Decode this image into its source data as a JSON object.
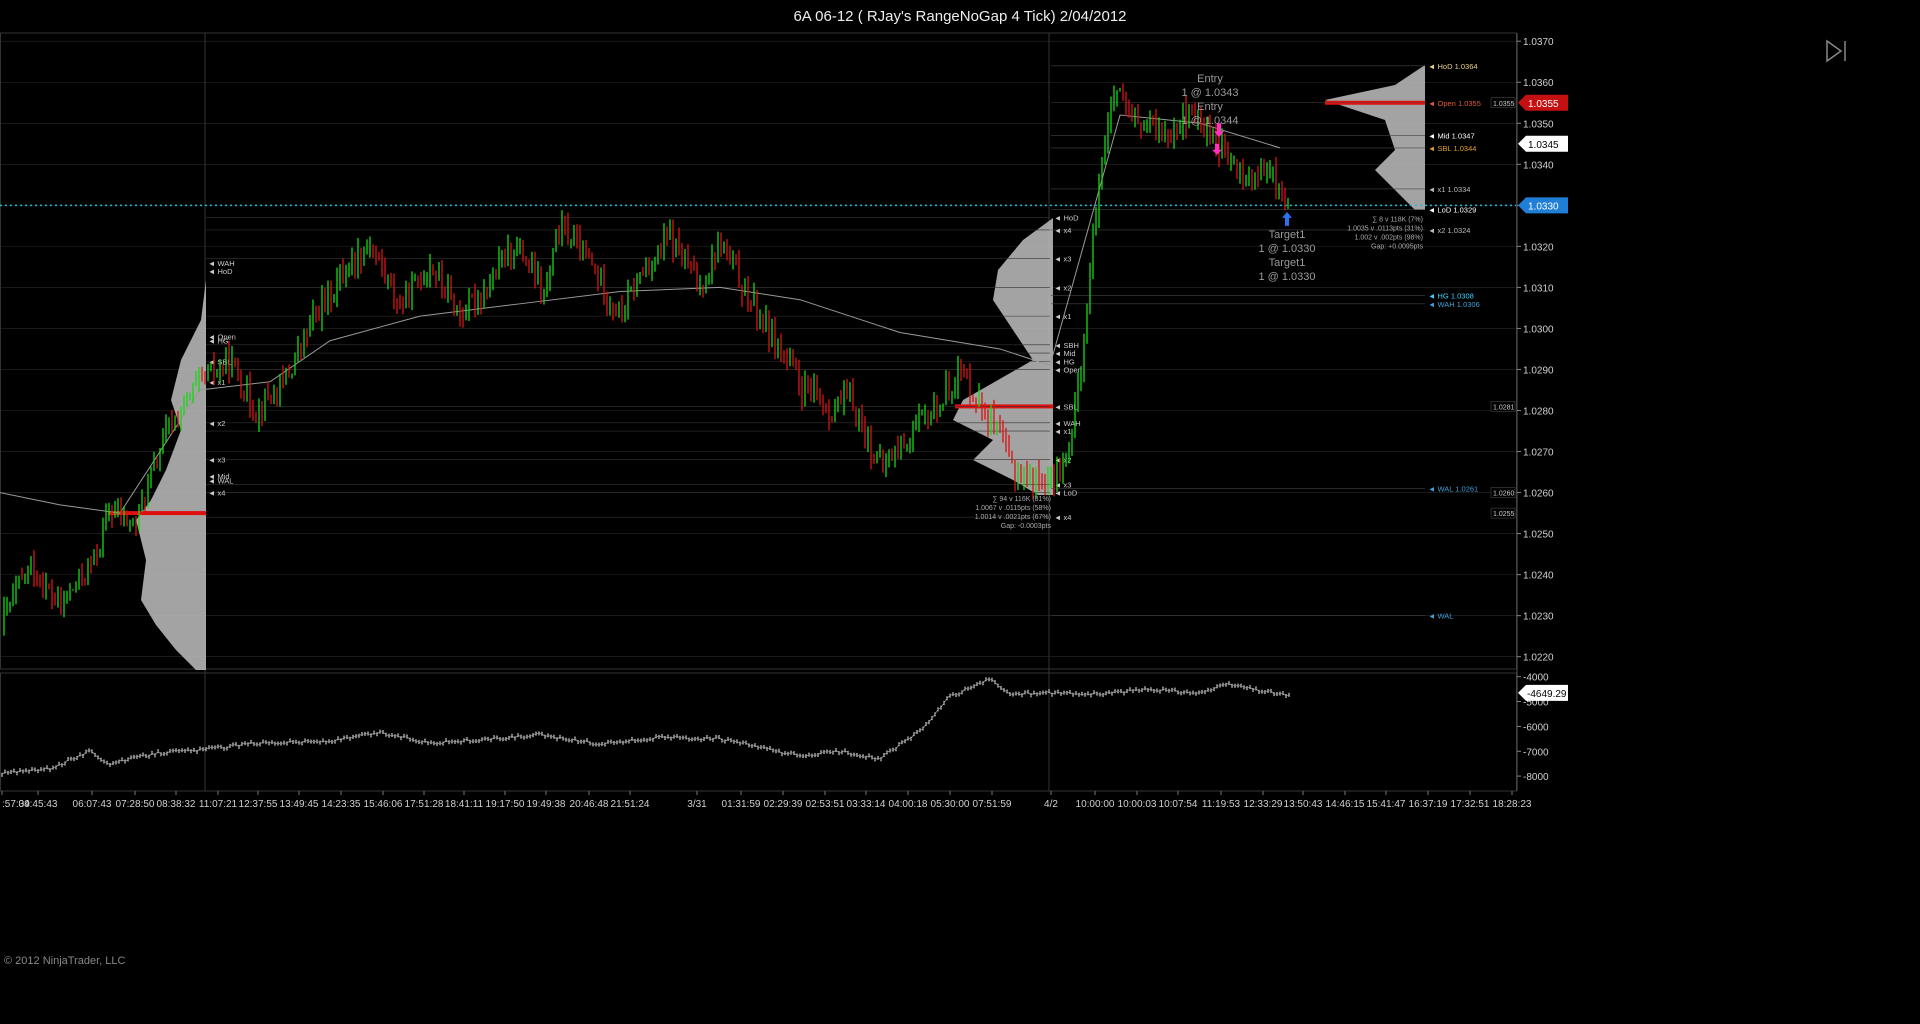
{
  "window": {
    "title": "6A 06-12 ( RJay's RangeNoGap  4 Tick)  2/04/2012"
  },
  "watermark": "© 2012 NinjaTrader, LLC",
  "colors": {
    "background": "#000000",
    "up_bar": "#12d912",
    "down_bar": "#d91212",
    "grid": "#2a2a2a",
    "price_label": "#c41010",
    "last_price_label": "#1f7fd6",
    "dotted_line": "#1fb9d6",
    "profile_fill": "#bfbfbf",
    "poc": "#e01010",
    "vwap_curve": "#9a9a9a"
  },
  "icons": [
    "play-to-end-icon"
  ],
  "chart_data": [
    {
      "type": "candlestick",
      "title": "6A 06-12 ( RJay's RangeNoGap  4 Tick)  2/04/2012",
      "ylim": [
        1.0217,
        1.0372
      ],
      "yticks": [
        "1.0370",
        "1.0360",
        "1.0350",
        "1.0340",
        "1.0330",
        "1.0320",
        "1.0310",
        "1.0300",
        "1.0290",
        "1.0280",
        "1.0270",
        "1.0260",
        "1.0250",
        "1.0240",
        "1.0230",
        "1.0220"
      ],
      "xticks": [
        ":57:39",
        "04:45:43",
        "06:07:43",
        "07:28:50",
        "08:38:32",
        "11:07:21",
        "12:37:55",
        "13:49:45",
        "14:23:35",
        "15:46:06",
        "17:51:28",
        "18:41:11",
        "19:17:50",
        "19:49:38",
        "20:46:48",
        "21:51:24",
        "3/31",
        "01:31:59",
        "02:29:39",
        "02:53:51",
        "03:33:14",
        "04:00:18",
        "05:30:00",
        "07:51:59",
        "4/2",
        "10:00:00",
        "10:00:03",
        "10:07:54",
        "11:19:53",
        "12:33:29",
        "13:50:43",
        "14:46:15",
        "15:41:47",
        "16:37:19",
        "17:32:51",
        "18:28:23"
      ],
      "price_anchors": [
        [
          0,
          1.0228
        ],
        [
          30,
          1.0242
        ],
        [
          60,
          1.0232
        ],
        [
          95,
          1.0244
        ],
        [
          110,
          1.0256
        ],
        [
          135,
          1.0252
        ],
        [
          165,
          1.0274
        ],
        [
          200,
          1.0287
        ],
        [
          230,
          1.0292
        ],
        [
          255,
          1.028
        ],
        [
          285,
          1.0287
        ],
        [
          315,
          1.0303
        ],
        [
          350,
          1.0316
        ],
        [
          370,
          1.0321
        ],
        [
          400,
          1.0305
        ],
        [
          430,
          1.0316
        ],
        [
          460,
          1.0303
        ],
        [
          490,
          1.0311
        ],
        [
          515,
          1.0321
        ],
        [
          545,
          1.0308
        ],
        [
          560,
          1.0325
        ],
        [
          590,
          1.0316
        ],
        [
          620,
          1.0303
        ],
        [
          640,
          1.0313
        ],
        [
          670,
          1.0322
        ],
        [
          700,
          1.031
        ],
        [
          720,
          1.0321
        ],
        [
          750,
          1.0307
        ],
        [
          780,
          1.0295
        ],
        [
          800,
          1.0286
        ],
        [
          830,
          1.028
        ],
        [
          850,
          1.0283
        ],
        [
          880,
          1.0266
        ],
        [
          910,
          1.0274
        ],
        [
          940,
          1.0282
        ],
        [
          960,
          1.029
        ],
        [
          990,
          1.0278
        ],
        [
          1015,
          1.0265
        ],
        [
          1050,
          1.0262
        ],
        [
          1070,
          1.027
        ],
        [
          1085,
          1.03
        ],
        [
          1100,
          1.034
        ],
        [
          1115,
          1.0358
        ],
        [
          1130,
          1.035
        ],
        [
          1160,
          1.0348
        ],
        [
          1190,
          1.0352
        ],
        [
          1210,
          1.0348
        ],
        [
          1230,
          1.034
        ],
        [
          1250,
          1.0336
        ],
        [
          1270,
          1.0338
        ],
        [
          1290,
          1.0329
        ]
      ],
      "vwap_anchors": [
        [
          0,
          1.026
        ],
        [
          60,
          1.0257
        ],
        [
          120,
          1.0255
        ],
        [
          200,
          1.0285
        ],
        [
          270,
          1.0287
        ],
        [
          330,
          1.0297
        ],
        [
          420,
          1.0303
        ],
        [
          520,
          1.0306
        ],
        [
          620,
          1.0309
        ],
        [
          720,
          1.031
        ],
        [
          800,
          1.0307
        ],
        [
          900,
          1.0299
        ],
        [
          1000,
          1.0295
        ],
        [
          1050,
          1.0291
        ],
        [
          1120,
          1.0352
        ],
        [
          1200,
          1.035
        ],
        [
          1280,
          1.0344
        ]
      ],
      "session_dividers": [
        "11:07:21",
        "4/2"
      ],
      "horizontal_levels": [
        {
          "label": "HoD 1.0364",
          "value": 1.0364,
          "color": "#e8d28a"
        },
        {
          "label": "Open 1.0355",
          "value": 1.0355,
          "color": "#e05a3a"
        },
        {
          "label": "Mid 1.0347",
          "value": 1.0347,
          "color": "#ffffff"
        },
        {
          "label": "SBL 1.0344",
          "value": 1.0344,
          "color": "#e0a020"
        },
        {
          "label": "x1 1.0334",
          "value": 1.0334,
          "color": "#bbbbbb"
        },
        {
          "label": "LoD 1.0329",
          "value": 1.0329,
          "color": "#ffffff"
        },
        {
          "label": "x2 1.0324",
          "value": 1.0324,
          "color": "#bbbbbb"
        },
        {
          "label": "HG 1.0308",
          "value": 1.0308,
          "color": "#3fd0ff"
        },
        {
          "label": "WAH 1.0306",
          "value": 1.0306,
          "color": "#3f9fd6"
        },
        {
          "label": "WAL 1.0261",
          "value": 1.0261,
          "color": "#3f9fd6"
        },
        {
          "label": "WAL",
          "value": 1.023,
          "color": "#3f9fd6"
        }
      ],
      "prior_session_labels": [
        {
          "label": "HoD",
          "value": 1.0327
        },
        {
          "label": "x4",
          "value": 1.0324
        },
        {
          "label": "x3",
          "value": 1.0317
        },
        {
          "label": "x2",
          "value": 1.031
        },
        {
          "label": "x1",
          "value": 1.0303
        },
        {
          "label": "SBH",
          "value": 1.0296
        },
        {
          "label": "Mid",
          "value": 1.0294
        },
        {
          "label": "HG",
          "value": 1.0292
        },
        {
          "label": "Open",
          "value": 1.029
        },
        {
          "label": "SBL",
          "value": 1.0281
        },
        {
          "label": "WAH",
          "value": 1.0277
        },
        {
          "label": "x1",
          "value": 1.0275
        },
        {
          "label": "x2",
          "value": 1.0268
        },
        {
          "label": "x3",
          "value": 1.0262
        },
        {
          "label": "LoD",
          "value": 1.026
        },
        {
          "label": "x4",
          "value": 1.0254
        }
      ],
      "first_session_labels": [
        {
          "label": "WAH",
          "value": 1.0316
        },
        {
          "label": "HoD",
          "value": 1.0314
        },
        {
          "label": "Open",
          "value": 1.0298
        },
        {
          "label": "HG",
          "value": 1.0297
        },
        {
          "label": "SBL",
          "value": 1.0292
        },
        {
          "label": "x1",
          "value": 1.0287
        },
        {
          "label": "x2",
          "value": 1.0277
        },
        {
          "label": "x3",
          "value": 1.0268
        },
        {
          "label": "Mid",
          "value": 1.0264
        },
        {
          "label": "WAL",
          "value": 1.0263
        },
        {
          "label": "x4",
          "value": 1.026
        }
      ],
      "right_price_labels": [
        {
          "label": "1.0355",
          "value": 1.0355,
          "style": "red"
        },
        {
          "label": "1.0345",
          "value": 1.0345,
          "style": "white"
        },
        {
          "label": "1.0330",
          "value": 1.033,
          "style": "blue"
        }
      ],
      "small_right_labels": [
        {
          "label": "1.0355",
          "value": 1.0355
        },
        {
          "label": "1.0281",
          "value": 1.0281
        },
        {
          "label": "1.0260",
          "value": 1.026
        },
        {
          "label": "1.0255",
          "value": 1.0255
        }
      ],
      "trade_annotations": [
        {
          "lines": [
            "Entry",
            "1 @ 1.0343",
            "Entry",
            "1 @ 1.0344"
          ],
          "x": 1210,
          "y": 1.036
        },
        {
          "lines": [
            "Target1",
            "1 @ 1.0330",
            "Target1",
            "1 @ 1.0330"
          ],
          "x": 1287,
          "y": 1.0322
        }
      ],
      "stats_boxes": [
        {
          "lines": [
            "∑ 8 v 118K (7%)",
            "1.0035 v .0113pts (31%)",
            "1.002 v .002pts (98%)",
            "Gap: +0.0095pts"
          ],
          "x": 1423,
          "y": 1.0326
        },
        {
          "lines": [
            "∑ 94 v 116K (81%)",
            "1.0067 v .0115pts (58%)",
            "1.0014 v .0021pts (67%)",
            "Gap: -0.0003pts"
          ],
          "x": 1051,
          "y": 1.0258
        }
      ]
    },
    {
      "type": "line",
      "title": "",
      "ylim": [
        -8600,
        -3850
      ],
      "yticks": [
        "-4000",
        "-5000",
        "-6000",
        "-7000",
        "-8000"
      ],
      "last_value_label": "-4649.29",
      "anchors": [
        [
          0,
          -7900
        ],
        [
          50,
          -7700
        ],
        [
          90,
          -7000
        ],
        [
          110,
          -7500
        ],
        [
          160,
          -7050
        ],
        [
          200,
          -6950
        ],
        [
          260,
          -6650
        ],
        [
          330,
          -6600
        ],
        [
          380,
          -6250
        ],
        [
          430,
          -6650
        ],
        [
          480,
          -6550
        ],
        [
          540,
          -6350
        ],
        [
          600,
          -6700
        ],
        [
          660,
          -6450
        ],
        [
          720,
          -6500
        ],
        [
          760,
          -6850
        ],
        [
          800,
          -7200
        ],
        [
          840,
          -7000
        ],
        [
          880,
          -7300
        ],
        [
          920,
          -6200
        ],
        [
          950,
          -4800
        ],
        [
          990,
          -4100
        ],
        [
          1010,
          -4700
        ],
        [
          1050,
          -4650
        ],
        [
          1100,
          -4700
        ],
        [
          1150,
          -4500
        ],
        [
          1200,
          -4650
        ],
        [
          1230,
          -4300
        ],
        [
          1260,
          -4550
        ],
        [
          1290,
          -4750
        ]
      ]
    }
  ]
}
